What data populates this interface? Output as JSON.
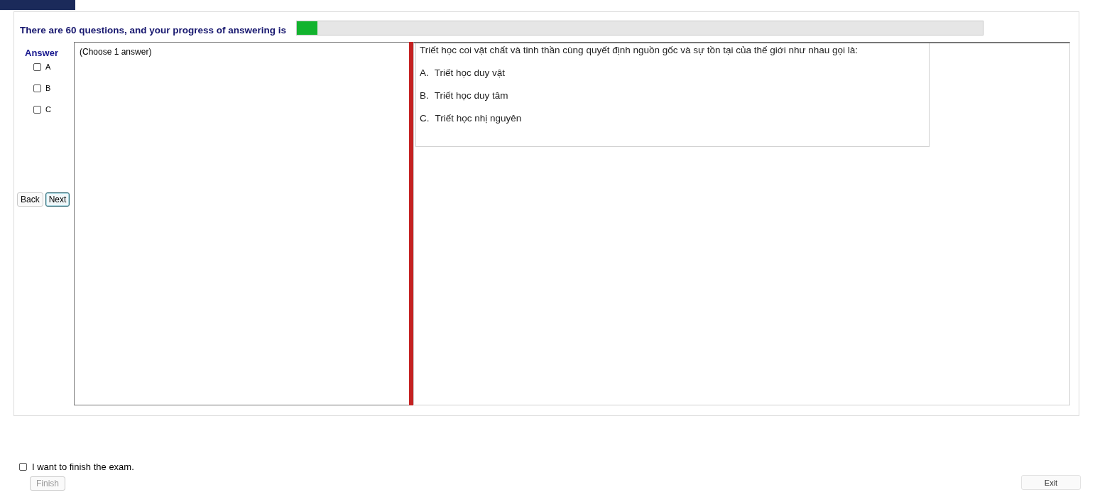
{
  "header": {
    "text": "There are 60 questions, and your progress of answering is",
    "progress": {
      "level": 0.03
    }
  },
  "answer_panel": {
    "title": "Answer",
    "options": [
      {
        "label": "A",
        "checked": false
      },
      {
        "label": "B",
        "checked": false
      },
      {
        "label": "C",
        "checked": false
      }
    ],
    "buttons": [
      {
        "label": "Back",
        "focused": false
      },
      {
        "label": "Next",
        "focused": true
      }
    ]
  },
  "instruction": "(Choose 1 answer)",
  "question": {
    "text": "Triết học coi vật chất và tinh thần cùng quyết định nguồn gốc và sự tồn tại của thế giới như nhau gọi là:",
    "choices": [
      {
        "letter": "A.",
        "text": "Triết học duy vật"
      },
      {
        "letter": "B.",
        "text": "Triết học duy tâm"
      },
      {
        "letter": "C.",
        "text": "Triết học nhị nguyên"
      }
    ]
  },
  "finish": {
    "label": "I want to finish the exam.",
    "checked": false,
    "button": "Finish",
    "button_disabled": true
  },
  "exit_button": "Exit"
}
